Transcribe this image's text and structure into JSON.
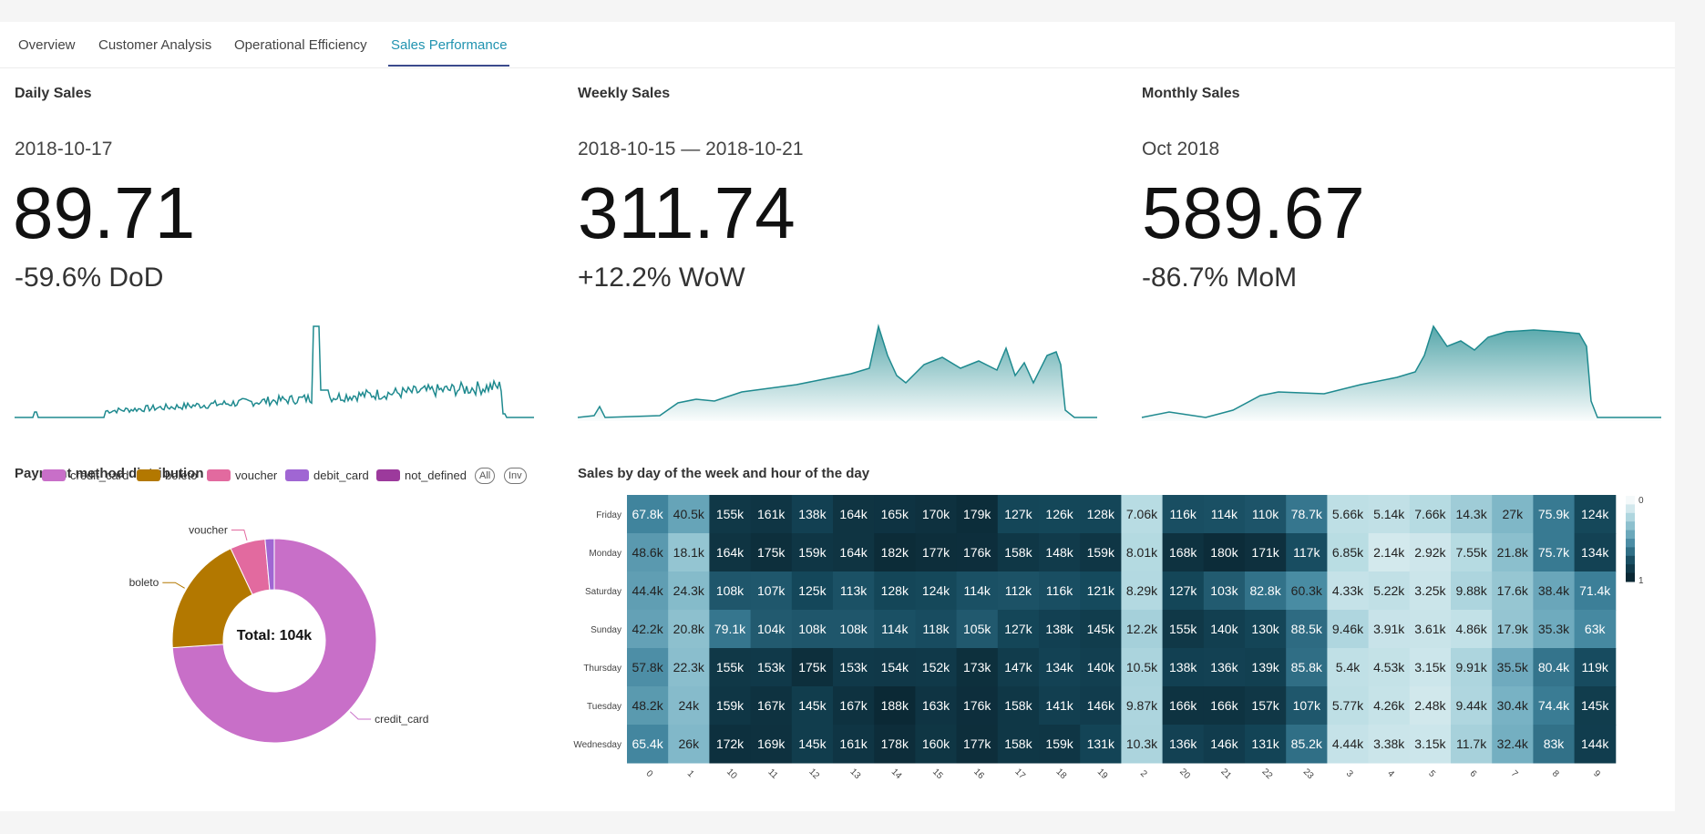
{
  "tabs": [
    {
      "label": "Overview",
      "active": false
    },
    {
      "label": "Customer Analysis",
      "active": false
    },
    {
      "label": "Operational Efficiency",
      "active": false
    },
    {
      "label": "Sales Performance",
      "active": true
    }
  ],
  "kpis": {
    "daily": {
      "title": "Daily Sales",
      "period": "2018-10-17",
      "value": "89.71",
      "change": "-59.6% DoD"
    },
    "weekly": {
      "title": "Weekly Sales",
      "period": "2018-10-15 — 2018-10-21",
      "value": "311.74",
      "change": "+12.2% WoW"
    },
    "monthly": {
      "title": "Monthly Sales",
      "period": "Oct 2018",
      "value": "589.67",
      "change": "-86.7% MoM"
    }
  },
  "payment": {
    "title": "Payment method distribution",
    "center_label": "Total: 104k",
    "legend_all": "All",
    "legend_inv": "Inv"
  },
  "heatmap": {
    "title": "Sales by day of the week and hour of the day",
    "scale_min_label": "0",
    "scale_max_label": "1"
  },
  "colors": {
    "accent": "#2193b0",
    "line": "#1f8a8f",
    "tab_underline": "#3b4a8c"
  },
  "chart_data": [
    {
      "type": "pie",
      "donut": true,
      "categories": [
        "credit_card",
        "boleto",
        "voucher",
        "debit_card",
        "not_defined"
      ],
      "values": [
        76800,
        19800,
        5800,
        1500,
        3
      ],
      "colors": [
        "#c86fc8",
        "#b37800",
        "#e26a9f",
        "#a066d3",
        "#9c3a9c"
      ],
      "slice_labels": [
        "credit_card",
        "boleto",
        "voucher"
      ],
      "legend": "top"
    },
    {
      "type": "heatmap",
      "x": [
        "0",
        "1",
        "10",
        "11",
        "12",
        "13",
        "14",
        "15",
        "16",
        "17",
        "18",
        "19",
        "2",
        "20",
        "21",
        "22",
        "23",
        "3",
        "4",
        "5",
        "6",
        "7",
        "8",
        "9"
      ],
      "y": [
        "Friday",
        "Monday",
        "Saturday",
        "Sunday",
        "Thursday",
        "Tuesday",
        "Wednesday"
      ],
      "value_labels": [
        [
          "67.8k",
          "40.5k",
          "155k",
          "161k",
          "138k",
          "164k",
          "165k",
          "170k",
          "179k",
          "127k",
          "126k",
          "128k",
          "7.06k",
          "116k",
          "114k",
          "110k",
          "78.7k",
          "5.66k",
          "5.14k",
          "7.66k",
          "14.3k",
          "27k",
          "75.9k",
          "124k"
        ],
        [
          "48.6k",
          "18.1k",
          "164k",
          "175k",
          "159k",
          "164k",
          "182k",
          "177k",
          "176k",
          "158k",
          "148k",
          "159k",
          "8.01k",
          "168k",
          "180k",
          "171k",
          "117k",
          "6.85k",
          "2.14k",
          "2.92k",
          "7.55k",
          "21.8k",
          "75.7k",
          "134k"
        ],
        [
          "44.4k",
          "24.3k",
          "108k",
          "107k",
          "125k",
          "113k",
          "128k",
          "124k",
          "114k",
          "112k",
          "116k",
          "121k",
          "8.29k",
          "127k",
          "103k",
          "82.8k",
          "60.3k",
          "4.33k",
          "5.22k",
          "3.25k",
          "9.88k",
          "17.6k",
          "38.4k",
          "71.4k"
        ],
        [
          "42.2k",
          "20.8k",
          "79.1k",
          "104k",
          "108k",
          "108k",
          "114k",
          "118k",
          "105k",
          "127k",
          "138k",
          "145k",
          "12.2k",
          "155k",
          "140k",
          "130k",
          "88.5k",
          "9.46k",
          "3.91k",
          "3.61k",
          "4.86k",
          "17.9k",
          "35.3k",
          "63k"
        ],
        [
          "57.8k",
          "22.3k",
          "155k",
          "153k",
          "175k",
          "153k",
          "154k",
          "152k",
          "173k",
          "147k",
          "134k",
          "140k",
          "10.5k",
          "138k",
          "136k",
          "139k",
          "85.8k",
          "5.4k",
          "4.53k",
          "3.15k",
          "9.91k",
          "35.5k",
          "80.4k",
          "119k"
        ],
        [
          "48.2k",
          "24k",
          "159k",
          "167k",
          "145k",
          "167k",
          "188k",
          "163k",
          "176k",
          "158k",
          "141k",
          "146k",
          "9.87k",
          "166k",
          "166k",
          "157k",
          "107k",
          "5.77k",
          "4.26k",
          "2.48k",
          "9.44k",
          "30.4k",
          "74.4k",
          "145k"
        ],
        [
          "65.4k",
          "26k",
          "172k",
          "169k",
          "145k",
          "161k",
          "178k",
          "160k",
          "177k",
          "158k",
          "159k",
          "131k",
          "10.3k",
          "136k",
          "146k",
          "131k",
          "85.2k",
          "4.44k",
          "3.38k",
          "3.15k",
          "11.7k",
          "32.4k",
          "83k",
          "144k"
        ]
      ],
      "colorscale_range": [
        0,
        1
      ]
    }
  ]
}
